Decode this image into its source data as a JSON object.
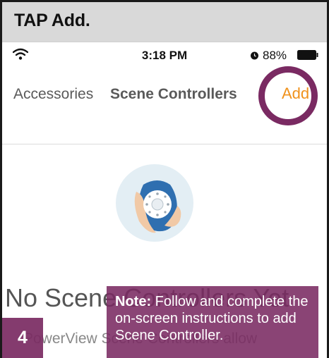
{
  "step": {
    "title": "TAP Add.",
    "number": "4"
  },
  "status_bar": {
    "time": "3:18 PM",
    "battery_percent": "88%"
  },
  "nav": {
    "back_label": "Accessories",
    "title": "Scene Controllers",
    "add_label": "Add"
  },
  "empty_state": {
    "title": "No Scene Controllers Yet",
    "subtitle": "PowerView Scene Controllers allow"
  },
  "note": {
    "label": "Note:",
    "text": "Follow and complete the on-screen instructions to add Scene Controller."
  },
  "colors": {
    "accent_purple": "#7a2a62",
    "add_orange": "#f0921c",
    "header_gray": "#d9d9d9"
  },
  "icons": [
    "wifi-icon",
    "alarm-icon",
    "battery-icon",
    "remote-illustration"
  ]
}
